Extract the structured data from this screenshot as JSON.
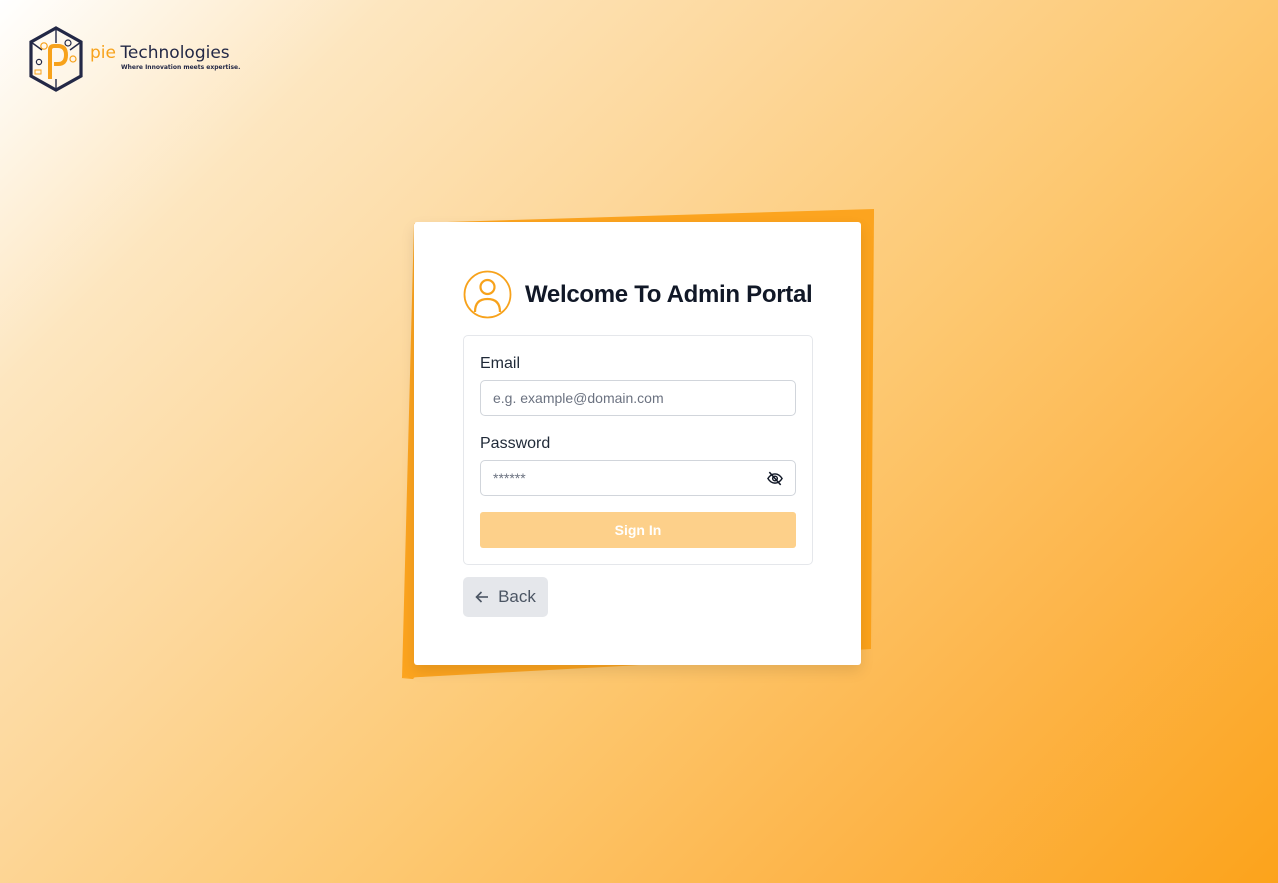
{
  "brand": {
    "name_part1": "pie",
    "name_part2": "Technologies",
    "tagline": "Where Innovation meets expertise.",
    "logo_icon": "hexagon-p-logo-icon",
    "accent_color": "#f7a21b",
    "dark_color": "#232846"
  },
  "card": {
    "title": "Welcome To Admin Portal",
    "avatar_icon": "user-circle-icon"
  },
  "form": {
    "email_label": "Email",
    "email_placeholder": "e.g. example@domain.com",
    "email_value": "",
    "password_label": "Password",
    "password_placeholder": "******",
    "password_value": "",
    "password_toggle_icon": "eye-off-icon",
    "submit_label": "Sign In"
  },
  "back": {
    "label": "Back",
    "icon": "arrow-left-icon"
  },
  "colors": {
    "accent": "#fba21b",
    "submit_disabled": "#fdd08a",
    "title": "#111827"
  }
}
